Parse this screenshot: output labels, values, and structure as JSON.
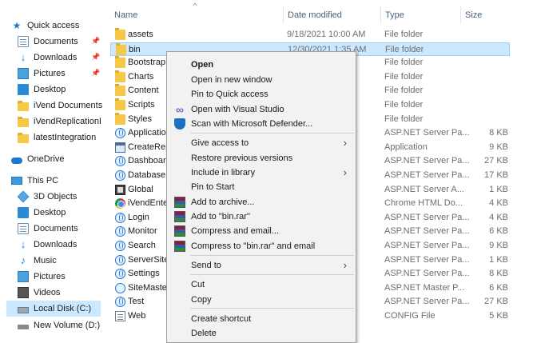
{
  "nav": {
    "quick_access": "Quick access",
    "items": [
      {
        "label": "Documents",
        "icon": "documents-icon",
        "pinned": true
      },
      {
        "label": "Downloads",
        "icon": "downloads-icon",
        "pinned": true
      },
      {
        "label": "Pictures",
        "icon": "pictures-icon",
        "pinned": true
      },
      {
        "label": "Desktop",
        "icon": "desktop-icon",
        "pinned": false
      },
      {
        "label": "iVend Documents",
        "icon": "folder-icon",
        "pinned": false
      },
      {
        "label": "iVendReplicationEng",
        "icon": "folder-icon",
        "pinned": false
      },
      {
        "label": "latestIntegration",
        "icon": "folder-icon",
        "pinned": false
      }
    ],
    "onedrive": "OneDrive",
    "this_pc": "This PC",
    "pc_items": [
      {
        "label": "3D Objects",
        "icon": "3d-objects-icon"
      },
      {
        "label": "Desktop",
        "icon": "desktop-icon"
      },
      {
        "label": "Documents",
        "icon": "documents-icon"
      },
      {
        "label": "Downloads",
        "icon": "downloads-icon"
      },
      {
        "label": "Music",
        "icon": "music-icon"
      },
      {
        "label": "Pictures",
        "icon": "pictures-icon"
      },
      {
        "label": "Videos",
        "icon": "videos-icon"
      },
      {
        "label": "Local Disk (C:)",
        "icon": "local-disk-icon"
      },
      {
        "label": "New Volume (D:)",
        "icon": "drive-icon"
      }
    ]
  },
  "columns": {
    "name": "Name",
    "date": "Date modified",
    "type": "Type",
    "size": "Size"
  },
  "files": [
    {
      "name": "assets",
      "date": "9/18/2021 10:00 AM",
      "type": "File folder",
      "size": "",
      "kind": "folder"
    },
    {
      "name": "bin",
      "date": "12/30/2021 1:35 AM",
      "type": "File folder",
      "size": "",
      "kind": "folder"
    },
    {
      "name": "Bootstrap",
      "date": "",
      "type": "File folder",
      "size": "",
      "kind": "folder"
    },
    {
      "name": "Charts",
      "date": "",
      "type": "File folder",
      "size": "",
      "kind": "folder"
    },
    {
      "name": "Content",
      "date": "",
      "type": "File folder",
      "size": "",
      "kind": "folder"
    },
    {
      "name": "Scripts",
      "date": "",
      "type": "File folder",
      "size": "",
      "kind": "folder"
    },
    {
      "name": "Styles",
      "date": "",
      "type": "File folder",
      "size": "",
      "kind": "folder"
    },
    {
      "name": "Application",
      "date": "",
      "type": "ASP.NET Server Pa...",
      "size": "8 KB",
      "kind": "globe"
    },
    {
      "name": "CreateRepli",
      "date": "",
      "type": "Application",
      "size": "9 KB",
      "kind": "app"
    },
    {
      "name": "Dashboard",
      "date": "",
      "type": "ASP.NET Server Pa...",
      "size": "27 KB",
      "kind": "globe"
    },
    {
      "name": "DatabaseHe",
      "date": "",
      "type": "ASP.NET Server Pa...",
      "size": "17 KB",
      "kind": "globe"
    },
    {
      "name": "Global",
      "date": "",
      "type": "ASP.NET Server A...",
      "size": "1 KB",
      "kind": "global"
    },
    {
      "name": "iVendEnterp",
      "date": "",
      "type": "Chrome HTML Do...",
      "size": "4 KB",
      "kind": "chrome"
    },
    {
      "name": "Login",
      "date": "",
      "type": "ASP.NET Server Pa...",
      "size": "4 KB",
      "kind": "globe"
    },
    {
      "name": "Monitor",
      "date": "",
      "type": "ASP.NET Server Pa...",
      "size": "6 KB",
      "kind": "globe"
    },
    {
      "name": "Search",
      "date": "",
      "type": "ASP.NET Server Pa...",
      "size": "9 KB",
      "kind": "globe"
    },
    {
      "name": "ServerSiteIc",
      "date": "",
      "type": "ASP.NET Server Pa...",
      "size": "1 KB",
      "kind": "globe"
    },
    {
      "name": "Settings",
      "date": "",
      "type": "ASP.NET Server Pa...",
      "size": "8 KB",
      "kind": "globe"
    },
    {
      "name": "SiteMaster",
      "date": "",
      "type": "ASP.NET Master P...",
      "size": "6 KB",
      "kind": "master"
    },
    {
      "name": "Test",
      "date": "",
      "type": "ASP.NET Server Pa...",
      "size": "27 KB",
      "kind": "globe"
    },
    {
      "name": "Web",
      "date": "",
      "type": "CONFIG File",
      "size": "5 KB",
      "kind": "config"
    }
  ],
  "context_menu": {
    "open": "Open",
    "open_new_window": "Open in new window",
    "pin_quick_access": "Pin to Quick access",
    "open_vs": "Open with Visual Studio",
    "scan_defender": "Scan with Microsoft Defender...",
    "give_access": "Give access to",
    "restore_versions": "Restore previous versions",
    "include_library": "Include in library",
    "pin_start": "Pin to Start",
    "add_archive": "Add to archive...",
    "add_bin_rar": "Add to \"bin.rar\"",
    "compress_email": "Compress and email...",
    "compress_bin_email": "Compress to \"bin.rar\" and email",
    "send_to": "Send to",
    "cut": "Cut",
    "copy": "Copy",
    "create_shortcut": "Create shortcut",
    "delete": "Delete"
  }
}
